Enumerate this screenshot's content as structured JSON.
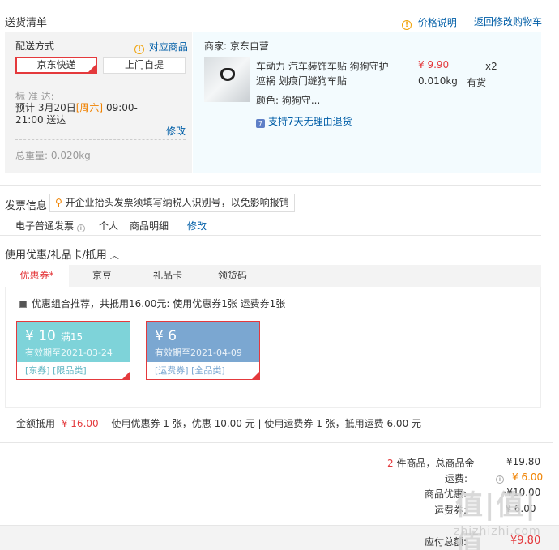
{
  "shipping_list": {
    "title": "送货清单",
    "price_note": "价格说明",
    "back_to_cart": "返回修改购物车",
    "delivery_method_label": "配送方式",
    "matching_items": "对应商品",
    "options": [
      "京东快递",
      "上门自提"
    ],
    "standard_label": "标 准 达:",
    "schedule_prefix": "预计 3月20日",
    "schedule_day": "[周六]",
    "schedule_time": "09:00-",
    "schedule_end": "21:00 送达",
    "modify": "修改",
    "total_weight_label": "总重量:",
    "total_weight": "0.020kg",
    "seller": "商家: 京东自营",
    "product_name_line1": "车动力 汽车装饰车贴 狗狗守护",
    "product_name_line2": "遮祸 划痕门缝狗车贴",
    "price": "¥ 9.90",
    "quantity": "x2",
    "weight": "0.010kg",
    "stock": "有货",
    "color": "颜色: 狗狗守...",
    "return_icon": "7",
    "return_policy": "支持7天无理由退货"
  },
  "invoice": {
    "title": "发票信息",
    "tip": "开企业抬头发票须填写纳税人识别号，以免影响报销",
    "type": "电子普通发票",
    "person": "个人",
    "detail": "商品明细",
    "modify": "修改"
  },
  "discount": {
    "title": "使用优惠/礼品卡/抵用",
    "tabs": [
      "优惠券",
      "京豆",
      "礼品卡",
      "领货码"
    ],
    "tab_marker": "*",
    "combo_text": "优惠组合推荐，共抵用16.00元: 使用优惠券1张 运费券1张",
    "coupons": [
      {
        "amount": "¥ 10",
        "condition": "满15",
        "expiry": "有效期至2021-03-24",
        "tags": "[东券]  [限品类]",
        "color": "#7ed3d9"
      },
      {
        "amount": "¥ 6",
        "condition": "",
        "expiry": "有效期至2021-04-09",
        "tags": "[运费券]  [全品类]",
        "color": "#7ba7d1"
      }
    ],
    "summary_label": "金额抵用",
    "summary_amount": "¥ 16.00",
    "summary_detail": "使用优惠券 1 张，优惠 10.00 元 | 使用运费券 1 张，抵用运费 6.00 元"
  },
  "totals": {
    "item_count": "2",
    "items_label": "件商品，总商品金",
    "items_amount": "¥19.80",
    "freight_label": "运费:",
    "freight_amount": "¥ 6.00",
    "discount_label": "商品优惠:",
    "discount_amount": "-¥10.00",
    "freight_coupon_label": "运费券:",
    "freight_coupon_amount": "-¥ 6.00",
    "payable_label": "应付总额:",
    "payable_amount": "¥9.80"
  },
  "watermark": {
    "main": "值|值|值",
    "sub": "zhizhizhi.com"
  },
  "colors": {
    "accent_red": "#e4393c",
    "link_blue": "#005ea7",
    "orange": "#f08200"
  }
}
